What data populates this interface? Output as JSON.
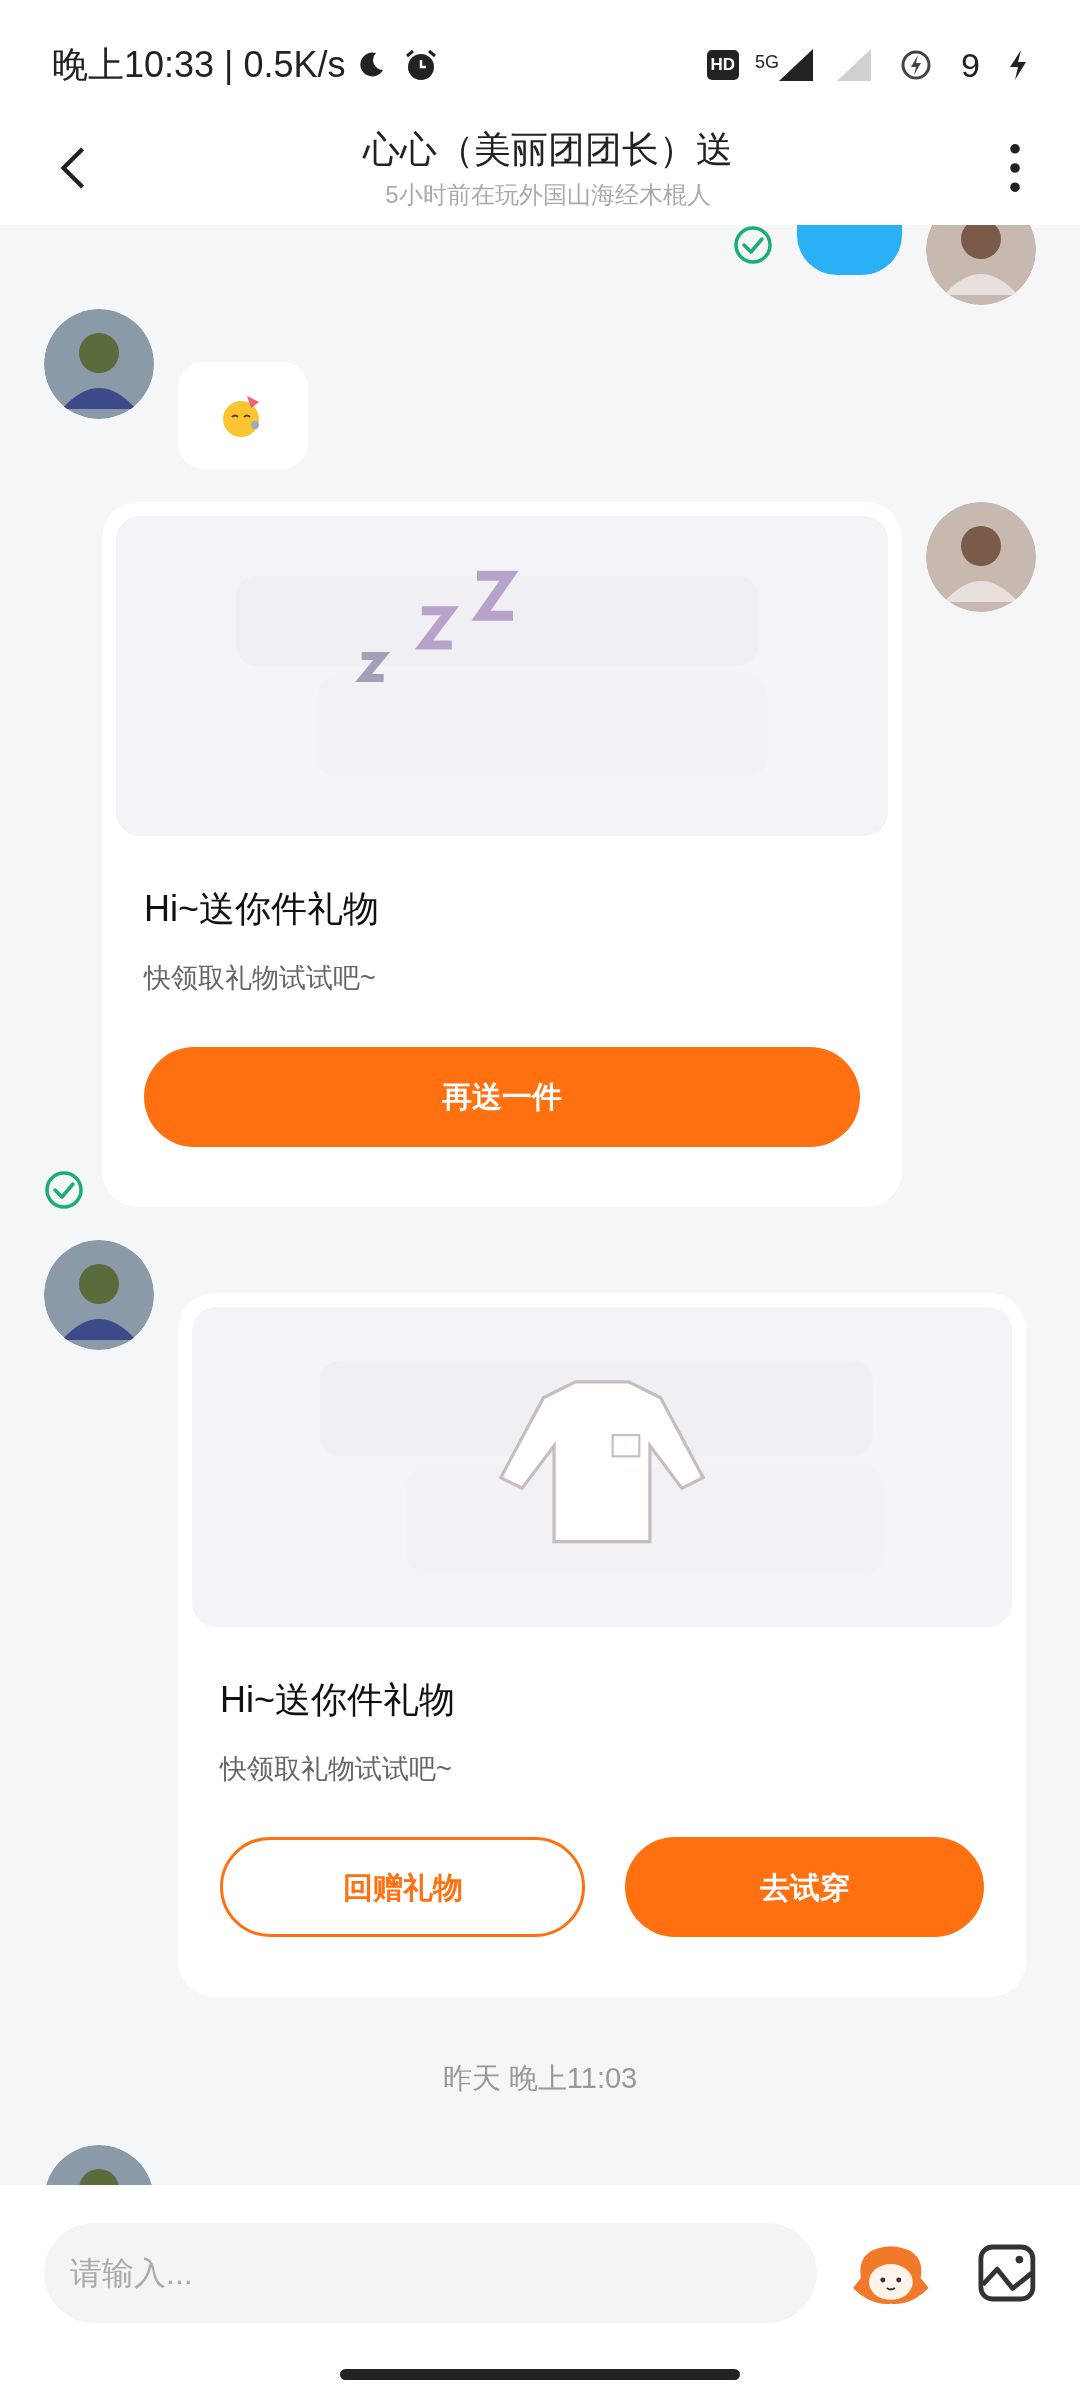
{
  "status_bar": {
    "time_speed": "晚上10:33 | 0.5K/s",
    "hd": "HD",
    "network": "5G",
    "battery": "9"
  },
  "header": {
    "title": "心心（美丽团团长）送",
    "subtitle": "5小时前在玩外国山海经木棍人"
  },
  "messages": [
    {
      "kind": "text_bubble",
      "outgoing": true,
      "read": true
    },
    {
      "kind": "emoji",
      "outgoing": false,
      "read": false
    },
    {
      "kind": "gift_card",
      "outgoing": true,
      "read": true,
      "picture": {
        "kind": "zzz"
      },
      "title": "Hi~送你件礼物",
      "subtitle": "快领取礼物试试吧~",
      "buttons": [
        {
          "label": "再送一件",
          "kind": "filled"
        }
      ]
    },
    {
      "kind": "gift_card",
      "outgoing": false,
      "read": false,
      "picture": {
        "kind": "jacket"
      },
      "title": "Hi~送你件礼物",
      "subtitle": "快领取礼物试试吧~",
      "buttons": [
        {
          "label": "回赠礼物",
          "kind": "outline"
        },
        {
          "label": "去试穿",
          "kind": "filled"
        }
      ]
    },
    {
      "kind": "timestamp",
      "text": "昨天 晚上11:03"
    },
    {
      "kind": "avatar_only",
      "outgoing": false
    }
  ],
  "input": {
    "placeholder": "请输入..."
  }
}
